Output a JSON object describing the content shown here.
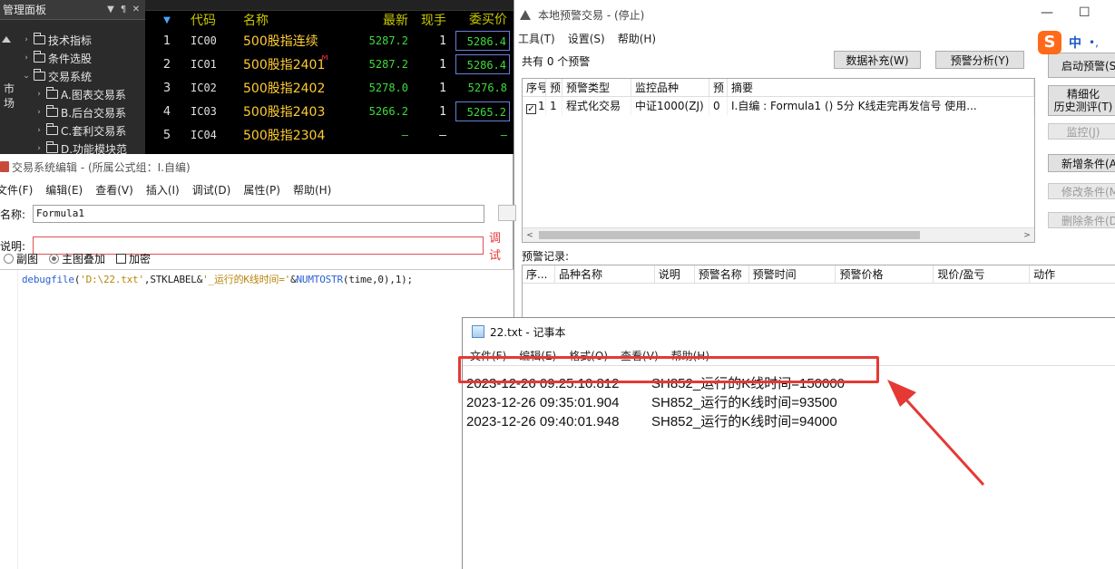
{
  "panel": {
    "title": "管理面板",
    "ctrl_dropdown": "▼",
    "ctrl_pin": "¶",
    "ctrl_close": "✕",
    "side_label": "市场",
    "tree": [
      {
        "label": "技术指标",
        "level": 1,
        "arrow": "›"
      },
      {
        "label": "条件选股",
        "level": 1,
        "arrow": "›"
      },
      {
        "label": "交易系统",
        "level": 1,
        "arrow": "⌄"
      },
      {
        "label": "A.图表交易系",
        "level": 2,
        "arrow": "›"
      },
      {
        "label": "B.后台交易系",
        "level": 2,
        "arrow": "›"
      },
      {
        "label": "C.套利交易系",
        "level": 2,
        "arrow": "›"
      },
      {
        "label": "D.功能模块范",
        "level": 2,
        "arrow": "›"
      }
    ]
  },
  "quote": {
    "headers": {
      "sort": "▼",
      "code": "代码",
      "name": "名称",
      "last": "最新",
      "hand": "现手",
      "bid": "委买价"
    },
    "rows": [
      {
        "idx": "1",
        "code": "IC00",
        "name": "500股指连续",
        "last": "5287.2",
        "hand": "1",
        "bid": "5286.4",
        "boxed": true,
        "mark": ""
      },
      {
        "idx": "2",
        "code": "IC01",
        "name": "500股指2401",
        "last": "5287.2",
        "hand": "1",
        "bid": "5286.4",
        "boxed": true,
        "mark": "M"
      },
      {
        "idx": "3",
        "code": "IC02",
        "name": "500股指2402",
        "last": "5278.0",
        "hand": "1",
        "bid": "5276.8",
        "boxed": false,
        "mark": ""
      },
      {
        "idx": "4",
        "code": "IC03",
        "name": "500股指2403",
        "last": "5266.2",
        "hand": "1",
        "bid": "5265.2",
        "boxed": true,
        "mark": ""
      },
      {
        "idx": "5",
        "code": "IC04",
        "name": "500股指2304",
        "last": "—",
        "hand": "—",
        "bid": "—",
        "boxed": false,
        "mark": ""
      }
    ]
  },
  "editor": {
    "title": "交易系统编辑 - (所属公式组：I.自编)",
    "menu": [
      "文件(F)",
      "编辑(E)",
      "查看(V)",
      "插入(I)",
      "调试(D)",
      "属性(P)",
      "帮助(H)"
    ],
    "name_label": "名称:",
    "name_value": "Formula1",
    "desc_label": "说明:",
    "desc_value": "",
    "debug_label": "调试",
    "opt_sub": "副图",
    "opt_main": "主图叠加",
    "opt_encrypt": "加密",
    "code": {
      "fn1": "debugfile",
      "p1": "(",
      "s1": "'D:\\22.txt'",
      "p2": ",STKLABEL&",
      "s2": "'_运行的K线时间='",
      "p3": "&",
      "fn2": "NUMTOSTR",
      "p4": "(time,0),1);"
    }
  },
  "alert": {
    "title": "本地预警交易 - (停止)",
    "menu": [
      "工具(T)",
      "设置(S)",
      "帮助(H)"
    ],
    "win_min": "—",
    "win_max": "☐",
    "count_text": "共有 0 个预警",
    "btn_supplement": "数据补充(W)",
    "btn_analysis": "预警分析(Y)",
    "btn_start": "启动预警(S)",
    "btn_history_l1": "精细化",
    "btn_history_l2": "历史测评(T)",
    "btn_monitor": "监控(J)",
    "btn_new": "新增条件(A)",
    "btn_modify": "修改条件(M)",
    "btn_delete": "删除条件(D)",
    "table_headers": [
      "序号",
      "预..",
      "预警类型",
      "监控品种",
      "预",
      "摘要"
    ],
    "table_rows": [
      {
        "seq": "1",
        "pre": "1",
        "type": "程式化交易",
        "symbol": "中证1000(ZJ)",
        "p": "0",
        "summary": "I.自编 : Formula1 () 5分 K线走完再发信号 使用..."
      }
    ],
    "scroll_left": "<",
    "scroll_right": ">",
    "record_label": "预警记录:",
    "record_headers": [
      "序...",
      "品种名称",
      "说明",
      "预警名称",
      "预警时间",
      "预警价格",
      "现价/盈亏",
      "动作"
    ]
  },
  "ime": {
    "logo": "S",
    "zh": "中",
    "punct": "•,"
  },
  "notepad": {
    "title": "22.txt - 记事本",
    "menu": [
      "文件(F)",
      "编辑(E)",
      "格式(O)",
      "查看(V)",
      "帮助(H)"
    ],
    "lines": [
      {
        "ts": "2023-12-26 09:25:10.812",
        "msg": "SH852_运行的K线时间=150000"
      },
      {
        "ts": "2023-12-26 09:35:01.904",
        "msg": "SH852_运行的K线时间=93500"
      },
      {
        "ts": "2023-12-26 09:40:01.948",
        "msg": "SH852_运行的K线时间=94000"
      }
    ]
  },
  "colors": {
    "highlight": "#e53935",
    "arrow": "#e53935",
    "ime": "#ff6a1a"
  }
}
